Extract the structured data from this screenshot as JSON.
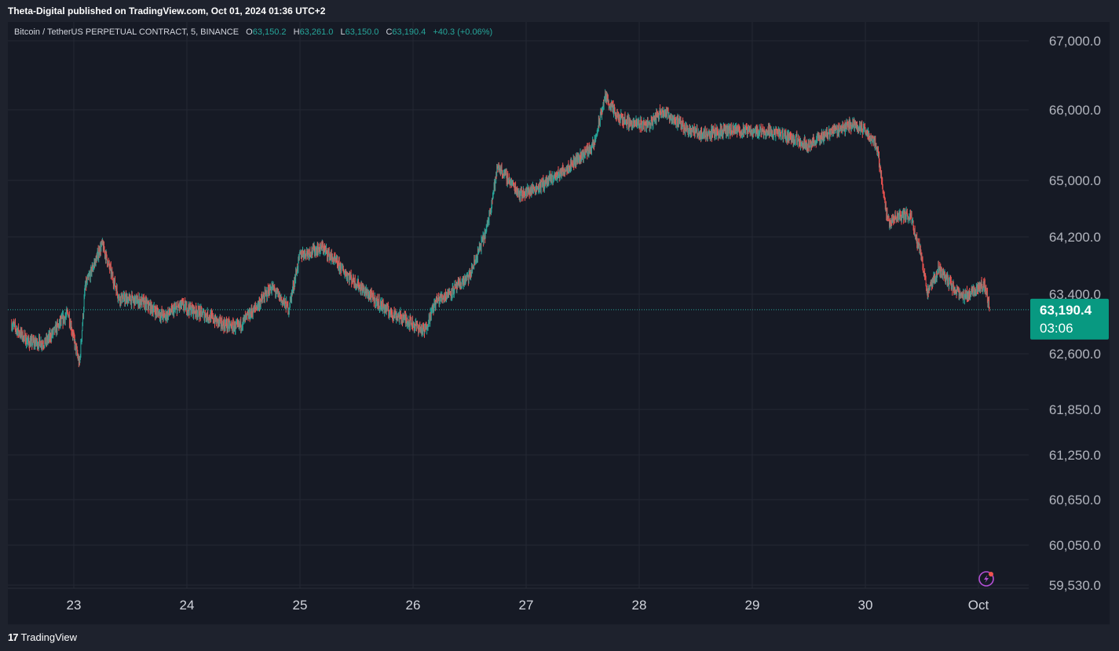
{
  "header": {
    "published": "Theta-Digital published on TradingView.com, Oct 01, 2024 01:36 UTC+2"
  },
  "legend": {
    "symbol": "Bitcoin / TetherUS PERPETUAL CONTRACT, 5, BINANCE",
    "open_label": "O",
    "open": "63,150.2",
    "high_label": "H",
    "high": "63,261.0",
    "low_label": "L",
    "low": "63,150.0",
    "close_label": "C",
    "close": "63,190.4",
    "change": "+40.3 (+0.06%)"
  },
  "price_badge": {
    "price": "63,190.4",
    "countdown": "03:06"
  },
  "footer": {
    "brand": "TradingView",
    "logo": "17"
  },
  "icons": {
    "alert": "lightning-alert-icon"
  },
  "colors": {
    "up": "#26a69a",
    "down": "#ef5350",
    "badge": "#089981",
    "background": "#161a25",
    "grid": "#242833"
  },
  "chart_data": {
    "type": "candlestick",
    "interval": "5",
    "last_price": 63190.4,
    "y_ticks": [
      {
        "value": 67000,
        "label": "67,000.0"
      },
      {
        "value": 66000,
        "label": "66,000.0"
      },
      {
        "value": 65000,
        "label": "65,000.0"
      },
      {
        "value": 64200,
        "label": "64,200.0"
      },
      {
        "value": 63400,
        "label": "63,400.0"
      },
      {
        "value": 62600,
        "label": "62,600.0"
      },
      {
        "value": 61850,
        "label": "61,850.0"
      },
      {
        "value": 61250,
        "label": "61,250.0"
      },
      {
        "value": 60650,
        "label": "60,650.0"
      },
      {
        "value": 60050,
        "label": "60,050.0"
      },
      {
        "value": 59530,
        "label": "59,530.0"
      }
    ],
    "x_ticks": [
      {
        "day": 23,
        "label": "23"
      },
      {
        "day": 24,
        "label": "24"
      },
      {
        "day": 25,
        "label": "25"
      },
      {
        "day": 26,
        "label": "26"
      },
      {
        "day": 27,
        "label": "27"
      },
      {
        "day": 28,
        "label": "28"
      },
      {
        "day": 29,
        "label": "29"
      },
      {
        "day": 30,
        "label": "30"
      },
      {
        "day": 31,
        "label": "Oct"
      }
    ],
    "price_path": [
      [
        22.45,
        63000
      ],
      [
        22.6,
        62750
      ],
      [
        22.75,
        62750
      ],
      [
        22.95,
        63150
      ],
      [
        23.05,
        62450
      ],
      [
        23.1,
        63500
      ],
      [
        23.25,
        64100
      ],
      [
        23.4,
        63350
      ],
      [
        23.6,
        63300
      ],
      [
        23.8,
        63100
      ],
      [
        23.95,
        63250
      ],
      [
        24.2,
        63100
      ],
      [
        24.3,
        63000
      ],
      [
        24.45,
        62950
      ],
      [
        24.6,
        63200
      ],
      [
        24.75,
        63500
      ],
      [
        24.9,
        63200
      ],
      [
        25.0,
        63950
      ],
      [
        25.2,
        64050
      ],
      [
        25.4,
        63700
      ],
      [
        25.6,
        63400
      ],
      [
        25.8,
        63150
      ],
      [
        25.95,
        63050
      ],
      [
        26.1,
        62900
      ],
      [
        26.2,
        63300
      ],
      [
        26.35,
        63450
      ],
      [
        26.5,
        63650
      ],
      [
        26.65,
        64300
      ],
      [
        26.75,
        65200
      ],
      [
        26.85,
        65000
      ],
      [
        26.95,
        64800
      ],
      [
        27.1,
        64900
      ],
      [
        27.3,
        65100
      ],
      [
        27.45,
        65300
      ],
      [
        27.6,
        65500
      ],
      [
        27.7,
        66200
      ],
      [
        27.8,
        65900
      ],
      [
        27.95,
        65800
      ],
      [
        28.1,
        65800
      ],
      [
        28.2,
        66000
      ],
      [
        28.4,
        65750
      ],
      [
        28.55,
        65650
      ],
      [
        28.75,
        65700
      ],
      [
        29.0,
        65700
      ],
      [
        29.15,
        65700
      ],
      [
        29.35,
        65600
      ],
      [
        29.5,
        65500
      ],
      [
        29.7,
        65700
      ],
      [
        29.9,
        65800
      ],
      [
        30.0,
        65700
      ],
      [
        30.1,
        65500
      ],
      [
        30.2,
        64400
      ],
      [
        30.3,
        64500
      ],
      [
        30.4,
        64500
      ],
      [
        30.5,
        63900
      ],
      [
        30.55,
        63400
      ],
      [
        30.65,
        63750
      ],
      [
        30.75,
        63550
      ],
      [
        30.85,
        63350
      ],
      [
        30.95,
        63450
      ],
      [
        31.05,
        63550
      ],
      [
        31.1,
        63190
      ]
    ]
  }
}
